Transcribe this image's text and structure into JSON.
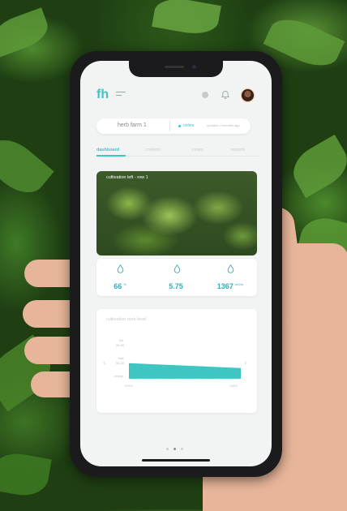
{
  "header": {
    "logo": "fh",
    "icons": [
      "menu-icon",
      "dot-icon",
      "bell-icon",
      "avatar"
    ]
  },
  "farm_bar": {
    "name": "herb farm 1",
    "status": "online",
    "updated": "updated 2 minutes ago"
  },
  "tabs": [
    {
      "label": "dashboard",
      "active": true
    },
    {
      "label": "controls",
      "active": false
    },
    {
      "label": "crops",
      "active": false
    },
    {
      "label": "reports",
      "active": false
    }
  ],
  "photo_card": {
    "title": "cultivation left - row 1"
  },
  "stats": [
    {
      "value": "66",
      "unit": "%",
      "icon": "water-drop-icon"
    },
    {
      "value": "5.75",
      "unit": "",
      "icon": "water-drop-icon"
    },
    {
      "value": "1367",
      "unit": "mS/m",
      "icon": "water-drop-icon"
    }
  ],
  "tank_card": {
    "title": "cultivation tank level",
    "y_labels": [
      "full",
      "06-30",
      "half",
      "06-30",
      "empty"
    ],
    "x_labels": [
      "07/01",
      "13/01"
    ],
    "level_start": 0.95,
    "level_end": 0.55
  },
  "colors": {
    "accent": "#3ec6c2",
    "stat_text": "#3aa9b8",
    "screen_bg": "#f2f4f4"
  }
}
